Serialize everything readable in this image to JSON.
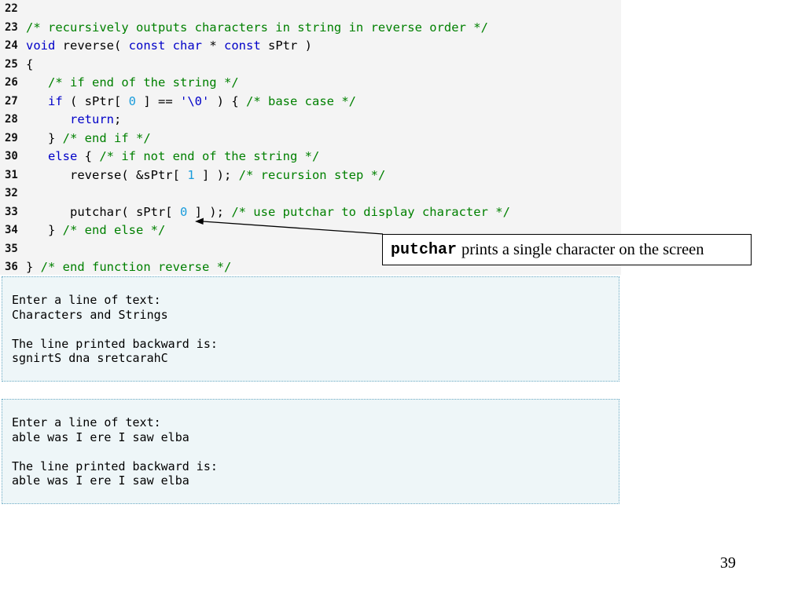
{
  "code": [
    {
      "ln": "22",
      "segs": []
    },
    {
      "ln": "23",
      "segs": [
        {
          "t": "/* recursively outputs characters in string in reverse order */",
          "c": "cm"
        }
      ]
    },
    {
      "ln": "24",
      "segs": [
        {
          "t": "void",
          "c": "kw"
        },
        {
          "t": " reverse( ",
          "c": ""
        },
        {
          "t": "const",
          "c": "kw"
        },
        {
          "t": " ",
          "c": ""
        },
        {
          "t": "char",
          "c": "kw"
        },
        {
          "t": " * ",
          "c": ""
        },
        {
          "t": "const",
          "c": "kw"
        },
        {
          "t": " sPtr )",
          "c": ""
        }
      ]
    },
    {
      "ln": "25",
      "segs": [
        {
          "t": "{",
          "c": ""
        }
      ]
    },
    {
      "ln": "26",
      "segs": [
        {
          "t": "   ",
          "c": ""
        },
        {
          "t": "/* if end of the string */",
          "c": "cm"
        }
      ]
    },
    {
      "ln": "27",
      "segs": [
        {
          "t": "   ",
          "c": ""
        },
        {
          "t": "if",
          "c": "kw"
        },
        {
          "t": " ( sPtr[ ",
          "c": ""
        },
        {
          "t": "0",
          "c": "num"
        },
        {
          "t": " ] == ",
          "c": ""
        },
        {
          "t": "'\\0'",
          "c": "str"
        },
        {
          "t": " ) { ",
          "c": ""
        },
        {
          "t": "/* base case */",
          "c": "cm"
        }
      ]
    },
    {
      "ln": "28",
      "segs": [
        {
          "t": "      ",
          "c": ""
        },
        {
          "t": "return",
          "c": "kw"
        },
        {
          "t": ";",
          "c": ""
        }
      ]
    },
    {
      "ln": "29",
      "segs": [
        {
          "t": "   } ",
          "c": ""
        },
        {
          "t": "/* end if */",
          "c": "cm"
        }
      ]
    },
    {
      "ln": "30",
      "segs": [
        {
          "t": "   ",
          "c": ""
        },
        {
          "t": "else",
          "c": "kw"
        },
        {
          "t": " { ",
          "c": ""
        },
        {
          "t": "/* if not end of the string */",
          "c": "cm"
        }
      ]
    },
    {
      "ln": "31",
      "segs": [
        {
          "t": "      reverse( &sPtr[ ",
          "c": ""
        },
        {
          "t": "1",
          "c": "num"
        },
        {
          "t": " ] ); ",
          "c": ""
        },
        {
          "t": "/* recursion step */",
          "c": "cm"
        }
      ]
    },
    {
      "ln": "32",
      "segs": []
    },
    {
      "ln": "33",
      "segs": [
        {
          "t": "      putchar( sPtr[ ",
          "c": ""
        },
        {
          "t": "0",
          "c": "num"
        },
        {
          "t": " ] ); ",
          "c": ""
        },
        {
          "t": "/* use putchar to display character */",
          "c": "cm"
        }
      ]
    },
    {
      "ln": "34",
      "segs": [
        {
          "t": "   } ",
          "c": ""
        },
        {
          "t": "/* end else */",
          "c": "cm"
        }
      ]
    },
    {
      "ln": "35",
      "segs": []
    },
    {
      "ln": "36",
      "segs": [
        {
          "t": "} ",
          "c": ""
        },
        {
          "t": "/* end function reverse */",
          "c": "cm"
        }
      ]
    }
  ],
  "output1": [
    "Enter a line of text:",
    "Characters and Strings",
    "",
    "The line printed backward is:",
    "sgnirtS dna sretcarahC"
  ],
  "output2": [
    "Enter a line of text:",
    "able was I ere I saw elba",
    "",
    "The line printed backward is:",
    "able was I ere I saw elba"
  ],
  "callout": {
    "code": "putchar",
    "text": "prints a single character on the screen"
  },
  "page_number": "39"
}
